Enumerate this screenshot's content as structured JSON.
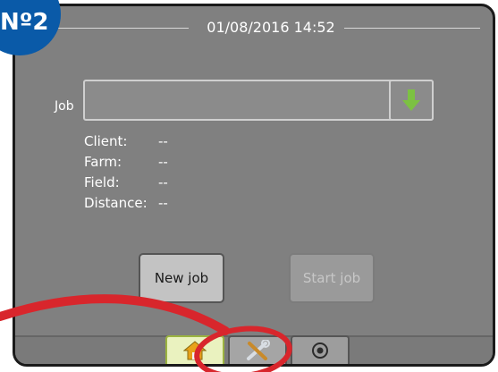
{
  "badge": {
    "text": "Nº2"
  },
  "header": {
    "datetime": "01/08/2016 14:52"
  },
  "job": {
    "label": "Job",
    "value": ""
  },
  "info": [
    {
      "key": "Client:",
      "value": "--"
    },
    {
      "key": "Farm:",
      "value": "--"
    },
    {
      "key": "Field:",
      "value": "--"
    },
    {
      "key": "Distance:",
      "value": "--"
    }
  ],
  "buttons": {
    "new_job": "New job",
    "start_job": "Start job"
  },
  "tabs": [
    {
      "icon": "home-icon",
      "active": true
    },
    {
      "icon": "tools-icon",
      "active": false
    },
    {
      "icon": "gps-icon",
      "active": false
    }
  ],
  "colors": {
    "badge": "#0a5aa8",
    "highlight": "#d8262c",
    "download_arrow": "#7cc142",
    "active_tab": "#eaf2bf"
  }
}
